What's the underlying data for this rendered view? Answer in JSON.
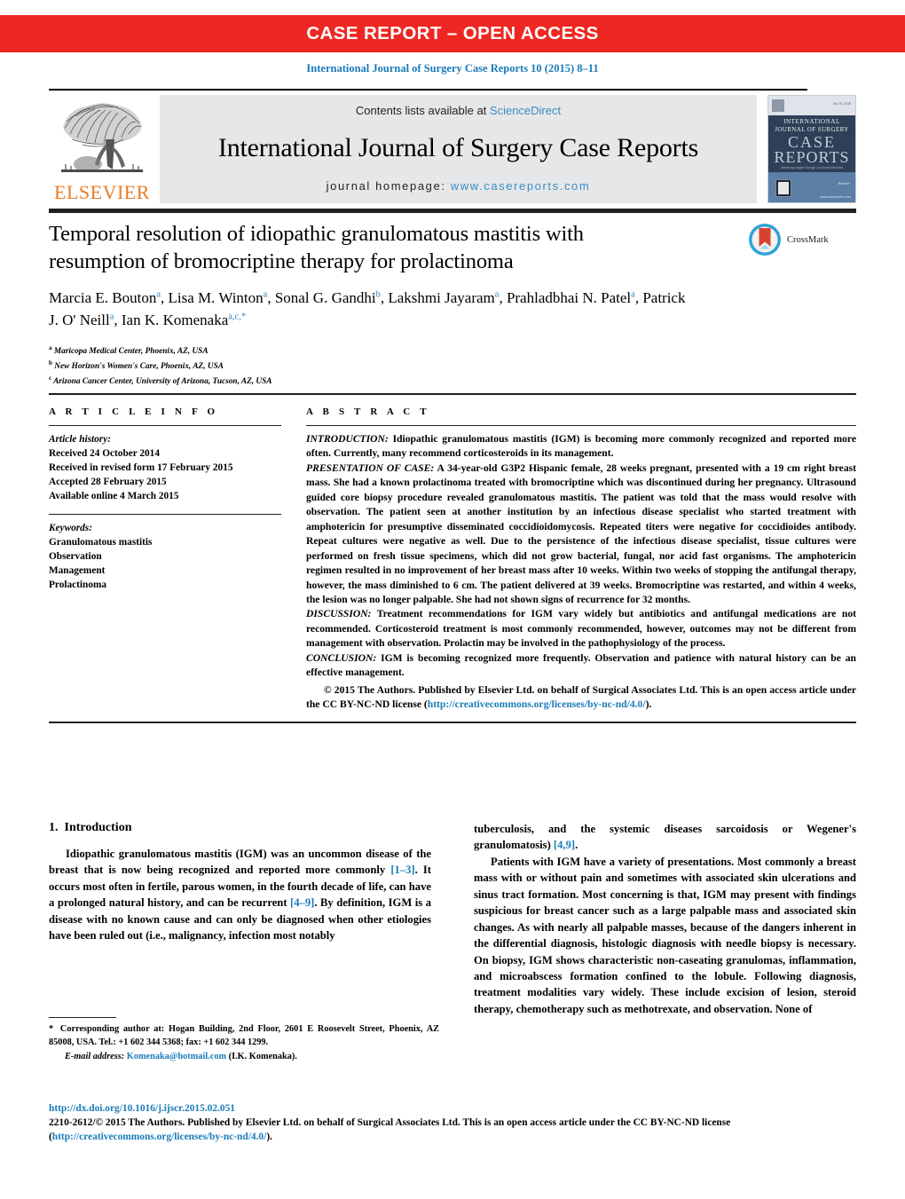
{
  "banner": {
    "label": "CASE REPORT – OPEN ACCESS"
  },
  "citation": {
    "line": "International Journal of Surgery Case Reports 10 (2015) 8–11"
  },
  "journal_header": {
    "contents_prefix": "Contents lists available at ",
    "sciencedirect": "ScienceDirect",
    "journal_title": "International Journal of Surgery Case Reports",
    "homepage_prefix": "journal homepage: ",
    "homepage_url": "www.casereports.com",
    "publisher_wordmark": "ELSEVIER",
    "cover": {
      "line1": "INTERNATIONAL",
      "line2": "JOURNAL OF SURGERY",
      "case": "CASE",
      "reports": "REPORTS",
      "subtitle": "Advancing surgery through case based education",
      "brand": "Elsevier",
      "url": "www.casereports.com",
      "corner": "Vol. 10, 2015"
    }
  },
  "article": {
    "title": "Temporal resolution of idiopathic granulomatous mastitis with resumption of bromocriptine therapy for prolactinoma",
    "authors_line_1": "Marcia E. Bouton",
    "authors": [
      {
        "name": "Marcia E. Bouton",
        "sup": "a"
      },
      {
        "name": "Lisa M. Winton",
        "sup": "a"
      },
      {
        "name": "Sonal G. Gandhi",
        "sup": "b"
      },
      {
        "name": "Lakshmi Jayaram",
        "sup": "a"
      },
      {
        "name": "Prahladbhai N. Patel",
        "sup": "a"
      },
      {
        "name": "Patrick J. O' Neill",
        "sup": "a"
      },
      {
        "name": "Ian K. Komenaka",
        "sup": "a,c,"
      }
    ],
    "affiliations": [
      {
        "mark": "a",
        "text": "Maricopa Medical Center, Phoenix, AZ, USA"
      },
      {
        "mark": "b",
        "text": "New Horizon's Women's Care, Phoenix, AZ, USA"
      },
      {
        "mark": "c",
        "text": "Arizona Cancer Center, University of Arizona, Tucson, AZ, USA"
      }
    ],
    "crossmark_label": "CrossMark"
  },
  "article_info": {
    "heading": "A R T I C L E   I N F O",
    "history_label": "Article history:",
    "history": [
      "Received 24 October 2014",
      "Received in revised form 17 February 2015",
      "Accepted 28 February 2015",
      "Available online 4 March 2015"
    ],
    "keywords_label": "Keywords:",
    "keywords": [
      "Granulomatous mastitis",
      "Observation",
      "Management",
      "Prolactinoma"
    ]
  },
  "abstract": {
    "heading": "A B S T R A C T",
    "sections": [
      {
        "lead": "INTRODUCTION:",
        "text": " Idiopathic granulomatous mastitis (IGM) is becoming more commonly recognized and reported more often. Currently, many recommend corticosteroids in its management."
      },
      {
        "lead": "PRESENTATION OF CASE:",
        "text": " A 34-year-old G3P2 Hispanic female, 28 weeks pregnant, presented with a 19 cm right breast mass. She had a known prolactinoma treated with bromocriptine which was discontinued during her pregnancy. Ultrasound guided core biopsy procedure revealed granulomatous mastitis. The patient was told that the mass would resolve with observation. The patient seen at another institution by an infectious disease specialist who started treatment with amphotericin for presumptive disseminated coccidioidomycosis. Repeated titers were negative for coccidioides antibody. Repeat cultures were negative as well. Due to the persistence of the infectious disease specialist, tissue cultures were performed on fresh tissue specimens, which did not grow bacterial, fungal, nor acid fast organisms. The amphotericin regimen resulted in no improvement of her breast mass after 10 weeks. Within two weeks of stopping the antifungal therapy, however, the mass diminished to 6 cm. The patient delivered at 39 weeks. Bromocriptine was restarted, and within 4 weeks, the lesion was no longer palpable. She had not shown signs of recurrence for 32 months."
      },
      {
        "lead": "DISCUSSION:",
        "text": " Treatment recommendations for IGM vary widely but antibiotics and antifungal medications are not recommended. Corticosteroid treatment is most commonly recommended, however, outcomes may not be different from management with observation. Prolactin may be involved in the pathophysiology of the process."
      },
      {
        "lead": "CONCLUSION:",
        "text": " IGM is becoming recognized more frequently. Observation and patience with natural history can be an effective management."
      }
    ],
    "copyright_pre": "© 2015 The Authors. Published by Elsevier Ltd. on behalf of Surgical Associates Ltd. This is an open access article under the CC BY-NC-ND license (",
    "copyright_link": "http://creativecommons.org/licenses/by-nc-nd/4.0/",
    "copyright_post": ")."
  },
  "body": {
    "section_number": "1.",
    "section_title": "Introduction",
    "left_paragraph_pre": "Idiopathic granulomatous mastitis (IGM) was an uncommon disease of the breast that is now being recognized and reported more commonly ",
    "ref_1": "[1–3]",
    "left_paragraph_mid": ". It occurs most often in fertile, parous women, in the fourth decade of life, can have a prolonged natural history, and can be recurrent ",
    "ref_2": "[4–9]",
    "left_paragraph_post": ". By definition, IGM is a disease with no known cause and can only be diagnosed when other etiologies have been ruled out (i.e., malignancy, infection most notably",
    "right_continue_pre": "tuberculosis, and the systemic diseases sarcoidosis or Wegener's granulomatosis) ",
    "ref_3": "[4,9]",
    "right_continue_post": ".",
    "right_paragraph": "Patients with IGM have a variety of presentations. Most commonly a breast mass with or without pain and sometimes with associated skin ulcerations and sinus tract formation. Most concerning is that, IGM may present with findings suspicious for breast cancer such as a large palpable mass and associated skin changes. As with nearly all palpable masses, because of the dangers inherent in the differential diagnosis, histologic diagnosis with needle biopsy is necessary. On biopsy, IGM shows characteristic non-caseating granulomas, inflammation, and microabscess formation confined to the lobule. Following diagnosis, treatment modalities vary widely. These include excision of lesion, steroid therapy, chemotherapy such as methotrexate, and observation. None of"
  },
  "footnote": {
    "star": "*",
    "text": " Corresponding author at: Hogan Building, 2nd Floor, 2601 E Roosevelt Street, Phoenix, AZ 85008, USA. Tel.: +1 602 344 5368; fax: +1 602 344 1299.",
    "email_label": "E-mail address:",
    "email": "Komenaka@hotmail.com",
    "email_attrib": " (I.K. Komenaka)."
  },
  "bottom": {
    "doi": "http://dx.doi.org/10.1016/j.ijscr.2015.02.051",
    "issn_copy_pre": "2210-2612/© 2015 The Authors. Published by Elsevier Ltd. on behalf of Surgical Associates Ltd. This is an open access article under the CC BY-NC-ND license (",
    "issn_copy_link": "http://creativecommons.org/licenses/by-nc-nd/4.0/",
    "issn_copy_post": ")."
  },
  "colors": {
    "banner_red": "#ee2722",
    "link_blue": "#1a7bb9",
    "elsevier_orange": "#e87b25",
    "band_grey": "#e6e7e8"
  }
}
